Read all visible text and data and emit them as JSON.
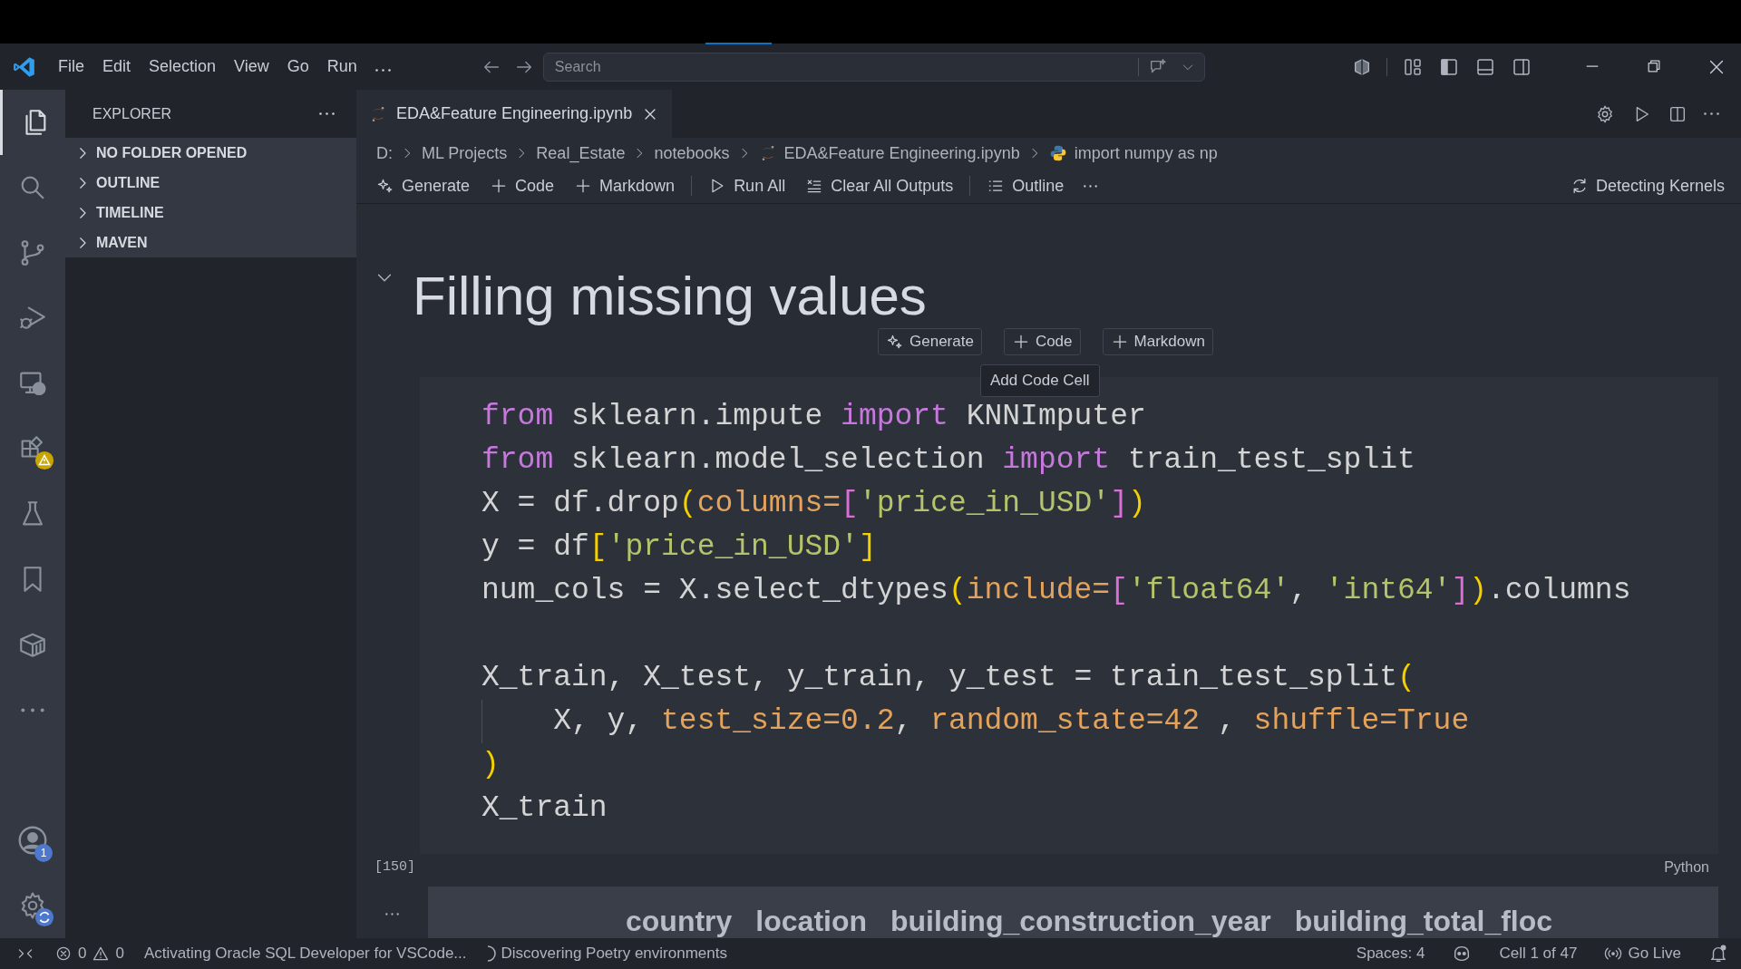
{
  "title_bar": {
    "menu": [
      "File",
      "Edit",
      "Selection",
      "View",
      "Go",
      "Run"
    ],
    "search": {
      "placeholder": "Search"
    }
  },
  "activity_bar": {
    "items": [
      {
        "selected": true
      },
      {
        "selected": false
      },
      {
        "selected": false
      },
      {
        "selected": false
      },
      {
        "selected": false
      },
      {
        "selected": false
      },
      {
        "selected": false
      },
      {
        "selected": false
      },
      {
        "selected": false
      },
      {
        "selected": false
      }
    ],
    "account_badge": "1"
  },
  "sidebar": {
    "title": "EXPLORER",
    "sections": [
      {
        "label": "NO FOLDER OPENED",
        "expanded": false
      },
      {
        "label": "OUTLINE",
        "expanded": false
      },
      {
        "label": "TIMELINE",
        "expanded": false
      },
      {
        "label": "MAVEN",
        "expanded": false
      }
    ]
  },
  "tabs": [
    {
      "label": "EDA&Feature Engineering.ipynb",
      "selected": true
    }
  ],
  "breadcrumbs": [
    {
      "label": "D:",
      "kind": "folder"
    },
    {
      "label": "ML Projects",
      "kind": "folder"
    },
    {
      "label": "Real_Estate",
      "kind": "folder"
    },
    {
      "label": "notebooks",
      "kind": "folder"
    },
    {
      "label": "EDA&Feature Engineering.ipynb",
      "kind": "notebook"
    },
    {
      "label": "import numpy as np",
      "kind": "python"
    }
  ],
  "notebook_toolbar": {
    "items": [
      {
        "label": "Generate",
        "kind": "generate"
      },
      {
        "label": "Code",
        "kind": "add"
      },
      {
        "label": "Markdown",
        "kind": "add"
      },
      {
        "label": "Run All",
        "kind": "run"
      },
      {
        "label": "Clear All Outputs",
        "kind": "clear"
      },
      {
        "label": "Outline",
        "kind": "outline"
      }
    ],
    "kernel": "Detecting Kernels"
  },
  "notebook": {
    "heading": "Filling missing values",
    "expanded": true,
    "insert_buttons": [
      {
        "label": "Generate",
        "kind": "generate"
      },
      {
        "label": "Code",
        "kind": "add"
      },
      {
        "label": "Markdown",
        "kind": "add"
      }
    ],
    "tooltip": "Add Code Cell",
    "cell": {
      "execution_count": "[150]",
      "language": "Python",
      "lines": [
        {
          "kind": "code",
          "tokens": [
            {
              "text": "from",
              "kind": "keyword"
            },
            {
              "text": " sklearn.impute ",
              "kind": "plain"
            },
            {
              "text": "import",
              "kind": "keyword"
            },
            {
              "text": " KNNImputer",
              "kind": "plain"
            }
          ]
        },
        {
          "kind": "code",
          "tokens": [
            {
              "text": "from",
              "kind": "keyword"
            },
            {
              "text": " sklearn.model_selection ",
              "kind": "plain"
            },
            {
              "text": "import",
              "kind": "keyword"
            },
            {
              "text": " train_test_split",
              "kind": "plain"
            }
          ]
        },
        {
          "kind": "code",
          "tokens": [
            {
              "text": "X = df.drop",
              "kind": "plain"
            },
            {
              "text": "(",
              "kind": "bracket1"
            },
            {
              "text": "columns=",
              "kind": "param"
            },
            {
              "text": "[",
              "kind": "bracket2"
            },
            {
              "text": "'price_in_USD'",
              "kind": "string"
            },
            {
              "text": "]",
              "kind": "bracket2"
            },
            {
              "text": ")",
              "kind": "bracket1"
            }
          ]
        },
        {
          "kind": "code",
          "tokens": [
            {
              "text": "y = df",
              "kind": "plain"
            },
            {
              "text": "[",
              "kind": "bracket1"
            },
            {
              "text": "'price_in_USD'",
              "kind": "string"
            },
            {
              "text": "]",
              "kind": "bracket1"
            }
          ]
        },
        {
          "kind": "code",
          "tokens": [
            {
              "text": "num_cols = X.select_dtypes",
              "kind": "plain"
            },
            {
              "text": "(",
              "kind": "bracket1"
            },
            {
              "text": "include=",
              "kind": "param"
            },
            {
              "text": "[",
              "kind": "bracket2"
            },
            {
              "text": "'float64'",
              "kind": "string"
            },
            {
              "text": ", ",
              "kind": "plain"
            },
            {
              "text": "'int64'",
              "kind": "string"
            },
            {
              "text": "]",
              "kind": "bracket2"
            },
            {
              "text": ")",
              "kind": "bracket1"
            },
            {
              "text": ".columns",
              "kind": "plain"
            }
          ]
        },
        {
          "kind": "blank"
        },
        {
          "kind": "code",
          "tokens": [
            {
              "text": "X_train, X_test, y_train, y_test = train_test_split",
              "kind": "plain"
            },
            {
              "text": "(",
              "kind": "bracket1"
            }
          ]
        },
        {
          "kind": "indented",
          "tokens": [
            {
              "text": "X, y, ",
              "kind": "plain"
            },
            {
              "text": "test_size=0.2",
              "kind": "param"
            },
            {
              "text": ", ",
              "kind": "plain"
            },
            {
              "text": "random_state=42",
              "kind": "param"
            },
            {
              "text": " , ",
              "kind": "plain"
            },
            {
              "text": "shuffle=True",
              "kind": "param"
            }
          ]
        },
        {
          "kind": "code",
          "tokens": [
            {
              "text": ")",
              "kind": "bracket1"
            }
          ]
        },
        {
          "kind": "code",
          "tokens": [
            {
              "text": "X_train",
              "kind": "plain"
            }
          ]
        }
      ]
    },
    "output": {
      "columns": [
        "country",
        "location",
        "building_construction_year",
        "building_total_floc"
      ]
    }
  },
  "status_bar": {
    "errors": "0",
    "warnings": "0",
    "left_items": [
      {
        "text": "Activating Oracle SQL Developer for VSCode...",
        "kind": "plain"
      },
      {
        "text": "Discovering Poetry environments",
        "kind": "progress"
      }
    ],
    "right_items": [
      {
        "text": "Spaces: 4",
        "kind": "plain"
      },
      {
        "kind": "copilot"
      },
      {
        "text": "Cell 1 of 47",
        "kind": "plain"
      },
      {
        "text": "Go Live",
        "kind": "live"
      },
      {
        "kind": "bell"
      }
    ]
  }
}
